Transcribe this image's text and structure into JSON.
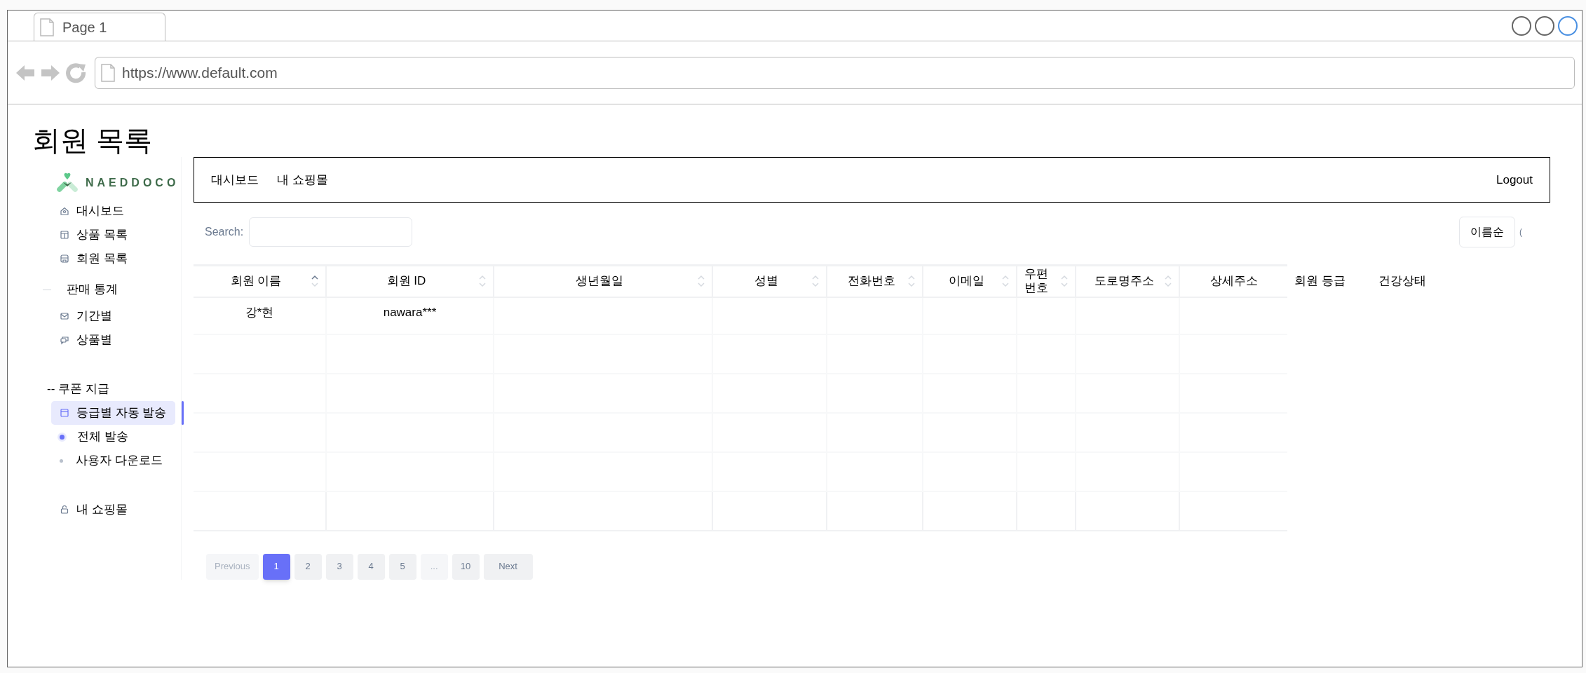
{
  "browser": {
    "tab": {
      "label": "Page 1"
    },
    "url": "https://www.default.com"
  },
  "page_title": "회원 목록",
  "sidebar": {
    "logo": "NAEDDOCO",
    "items": [
      {
        "kind": "link",
        "label": "대시보드",
        "selected": false
      },
      {
        "kind": "link",
        "label": "상품 목록",
        "selected": false
      },
      {
        "kind": "link",
        "label": "회원 목록",
        "selected": false
      },
      {
        "kind": "section",
        "label": "판매 통계"
      },
      {
        "kind": "link",
        "label": "기간별",
        "selected": false
      },
      {
        "kind": "link",
        "label": "상품별",
        "selected": false
      },
      {
        "kind": "heading",
        "label": "-- 쿠폰 지급"
      },
      {
        "kind": "link",
        "label": "등급별 자동 발송",
        "selected": true
      },
      {
        "kind": "dot",
        "label": "전체 발송",
        "active": true
      },
      {
        "kind": "dot",
        "label": "사용자 다운로드",
        "active": false
      },
      {
        "kind": "link",
        "label": "내 쇼핑몰",
        "selected": false
      }
    ]
  },
  "top_nav": {
    "links": [
      "대시보드",
      "내 쇼핑몰"
    ],
    "logout": "Logout"
  },
  "search": {
    "label": "Search:"
  },
  "sort_button": "이름순",
  "sort_button_trail": "(",
  "table": {
    "columns": [
      {
        "label": "회원 이름",
        "sortable": true,
        "sorted": true
      },
      {
        "label": "회원 ID",
        "sortable": true,
        "sorted": false
      },
      {
        "label": "생년월일",
        "sortable": true,
        "sorted": false
      },
      {
        "label": "성별",
        "sortable": true,
        "sorted": false
      },
      {
        "label": "전화번호",
        "sortable": true,
        "sorted": false
      },
      {
        "label": "이메일",
        "sortable": true,
        "sorted": false
      },
      {
        "label": "우편번호",
        "sortable": true,
        "sorted": false
      },
      {
        "label": "도로명주소",
        "sortable": true,
        "sorted": false
      },
      {
        "label": "상세주소",
        "sortable": false
      },
      {
        "label": "회원 등급",
        "sortable": false
      },
      {
        "label": "건강상태",
        "sortable": false
      }
    ],
    "rows": [
      [
        "강*현",
        "nawara***"
      ]
    ]
  },
  "pagination": [
    {
      "kind": "prev",
      "label": "Previous",
      "disabled": true
    },
    {
      "kind": "page",
      "label": "1",
      "selected": true
    },
    {
      "kind": "page",
      "label": "2",
      "selected": false
    },
    {
      "kind": "page",
      "label": "3",
      "selected": false
    },
    {
      "kind": "page",
      "label": "4",
      "selected": false
    },
    {
      "kind": "page",
      "label": "5",
      "selected": false
    },
    {
      "kind": "ellipsis",
      "label": "..."
    },
    {
      "kind": "page",
      "label": "10",
      "selected": false
    },
    {
      "kind": "next",
      "label": "Next",
      "disabled": false
    }
  ]
}
